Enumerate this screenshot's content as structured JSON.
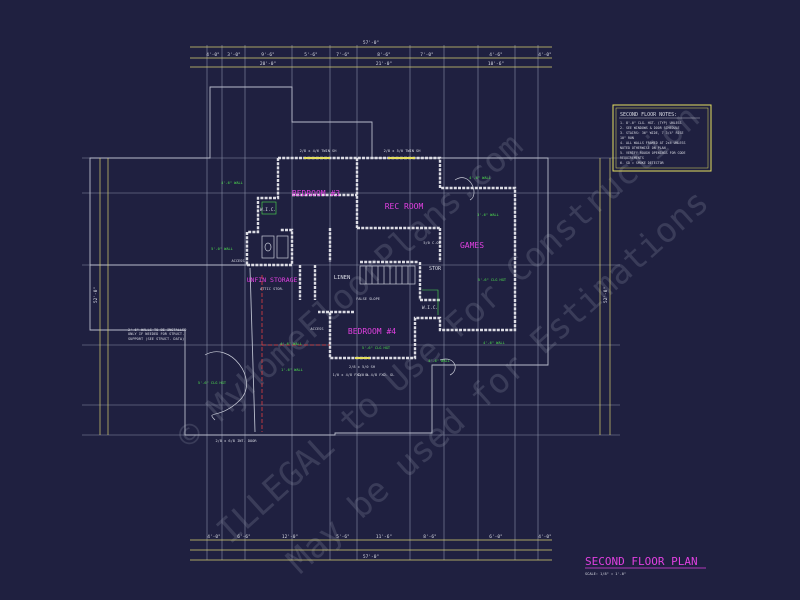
{
  "colors": {
    "background": "#1f2040",
    "lines": "#c9ccd8",
    "dimension_lines": "#d8d070",
    "walls": "#dcdce4",
    "room_labels": "#e040e0",
    "annotation": "#4ee04e",
    "title": "#e040e0",
    "notes_border": "#e6e060",
    "watermark": "#9aa0b4",
    "bearing_line": "#e04040"
  },
  "rooms": {
    "bedroom3": "BEDROOM #3",
    "rec_room": "REC ROOM",
    "games": "GAMES",
    "bedroom4": "BEDROOM #4",
    "unfin_storage": "UNFIN STORAGE",
    "linen": "LINEN",
    "stor": "STOR",
    "wic_left": "W.I.C.",
    "wic_right": "W.I.C."
  },
  "labels": {
    "access_left": "ACCESS",
    "access_lower": "ACCESS",
    "wall_4ft": "4'-6\" WALL",
    "wall_5ft": "5'-0\" WALL",
    "wall_3ft": "3'-6\" WALL",
    "wall_1ft": "1'-6\" WALL",
    "clg_ht": "5'-6\" CLG HGT",
    "twin_bed_left": "2/8 x 4/6 TWIN SH",
    "twin_bed_right": "2/8 x 5/0 TWIN SH",
    "false_slope": "FALSE SLOPE",
    "co": "5/0 C.O.",
    "lowest_window": "2/8 x 5/0 SH",
    "fxd_gl_left": "1/0 x 4/8 FXD. GL",
    "fxd_gl_right": "1/0 x 4/8 FXD. GL",
    "storage_note": "2'-6\" WALLS TO BE INSTALLED ONLY IF NEEDED FOR STRUCT. SUPPORT (SEE STRUCT. DATA)",
    "unfin_note": "ATTIC STOR.",
    "bottom_door": "2/8 x 6/8 INT. DOOR"
  },
  "notes": {
    "title": "SECOND FLOOR NOTES:",
    "items": [
      "1. 8'-0\" CLG. HGT. (TYP) UNLESS",
      "2. SEE WINDOWS & DOOR SCHEDULE",
      "3. STAIRS: 36\" WIDE, 7 3/4\" RISE",
      "   10\" RUN",
      "4. ALL WALLS FRAMED AT 2x4 UNLESS",
      "   NOTED OTHERWISE ON PLAN",
      "5. VERIFY ROUGH OPENINGS FOR CODE",
      "   REQUIREMENTS",
      "6. SD = SMOKE DETECTOR"
    ]
  },
  "dimensions": {
    "top_overall": "57'-0\"",
    "top_row": [
      "4'-0\"",
      "3'-0\"",
      "9'-6\"",
      "5'-6\"",
      "7'-6\"",
      "8'-6\"",
      "7'-0\"",
      "4'-6\"",
      "4'-0\""
    ],
    "top_second": [
      "20'-0\"",
      "21'-0\"",
      "10'-6\""
    ],
    "left_overall": "52'-0\"",
    "right_overall": "52'-0\"",
    "bottom_row": [
      "4'-0\"",
      "6'-6\"",
      "12'-0\"",
      "5'-6\"",
      "11'-6\"",
      "8'-6\"",
      "6'-0\"",
      "4'-0\""
    ],
    "bottom_overall": "57'-0\""
  },
  "title": {
    "main": "SECOND FLOOR PLAN",
    "scale": "SCALE: 1/8\" = 1'-0\""
  },
  "watermark": {
    "line1": "© MyHomeFloorPlans.com",
    "line2": "ILLEGAL to Use For Construction",
    "line3": "May be used for Estimations"
  }
}
